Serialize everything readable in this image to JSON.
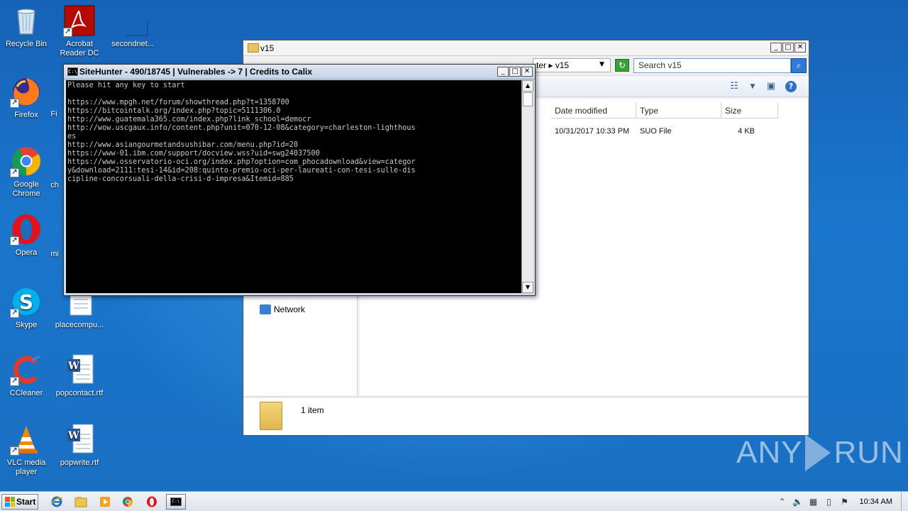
{
  "desktop": {
    "icons": [
      {
        "label": "Recycle Bin"
      },
      {
        "label": "Acrobat Reader DC"
      },
      {
        "label": "secondnet..."
      },
      {
        "label": "Firefox"
      },
      {
        "label": "Google Chrome"
      },
      {
        "label": "Opera"
      },
      {
        "label": "Skype"
      },
      {
        "label": "placecompu..."
      },
      {
        "label": "CCleaner"
      },
      {
        "label": "popcontact.rtf"
      },
      {
        "label": "VLC media player"
      },
      {
        "label": "popwrite.rtf"
      }
    ],
    "partial_labels": [
      "Fi",
      "ch",
      "mi"
    ]
  },
  "explorer": {
    "title": "v15",
    "address_tail": "ter ▸ v15",
    "search_placeholder": "Search v15",
    "columns": [
      "Date modified",
      "Type",
      "Size"
    ],
    "files": [
      {
        "date_modified": "10/31/2017 10:33 PM",
        "type": "SUO File",
        "size": "4 KB"
      }
    ],
    "nav_network": "Network",
    "status_text": "1 item"
  },
  "console": {
    "title": "SiteHunter - 490/18745 | Vulnerables -> 7 | Credits to Calix",
    "lines": "Please hit any key to start\n\nhttps://www.mpgh.net/forum/showthread.php?t=1358700\nhttps://bitcointalk.org/index.php?topic=5111306.0\nhttp://www.guatemala365.com/index.php?link_school=democr\nhttp://wow.uscgaux.info/content.php?unit=070-12-08&category=charleston-lighthous\nes\nhttp://www.asiangourmetandsushibar.com/menu.php?id=20\nhttps://www-01.ibm.com/support/docview.wss?uid=swg24037500\nhttps://www.osservatorio-oci.org/index.php?option=com_phocadownload&view=categor\ny&download=2111:tesi-14&id=208:quinto-premio-oci-per-laureati-con-tesi-sulle-dis\ncipline-concorsuali-della-crisi-d-impresa&Itemid=885"
  },
  "taskbar": {
    "start_label": "Start",
    "clock": "10:34 AM"
  },
  "watermark": {
    "left": "ANY",
    "right": "RUN"
  },
  "colors": {
    "desktop": "#1c6dbd",
    "console_bg": "#000000",
    "console_text": "#c9c9c9"
  }
}
